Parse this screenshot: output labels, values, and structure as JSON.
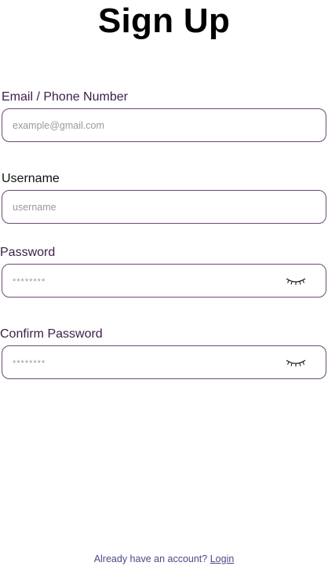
{
  "title": "Sign Up",
  "fields": [
    {
      "label": "Email / Phone Number",
      "placeholder": "example@gmail.com",
      "value": ""
    },
    {
      "label": "Username",
      "placeholder": "username",
      "value": ""
    },
    {
      "label": "Password",
      "placeholder": "********",
      "value": "",
      "icon": "eye-closed-icon"
    },
    {
      "label": "Confirm Password",
      "placeholder": "********",
      "value": "",
      "icon": "eye-closed-icon"
    }
  ],
  "footer": {
    "prompt": "Already have an account?",
    "link_label": "Login"
  },
  "colors": {
    "field_border": "#6b4a73",
    "label_text": "#3b1f45",
    "footer_text": "#4a4a8a"
  }
}
